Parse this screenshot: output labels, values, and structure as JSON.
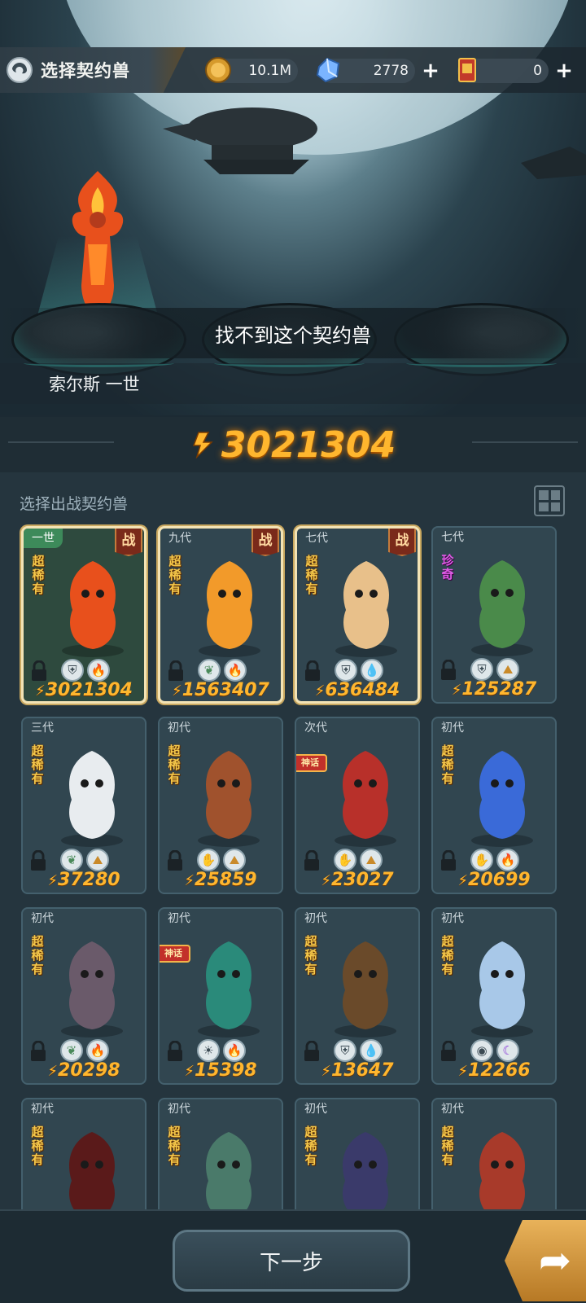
{
  "header": {
    "title": "选择契约兽",
    "gold": "10.1M",
    "crystals": "2778",
    "tickets": "0"
  },
  "stage": {
    "status_message": "找不到这个契约兽",
    "hero_name": "索尔斯 一世",
    "total_power": "3021304"
  },
  "list": {
    "section_label": "选择出战契约兽",
    "cards": [
      {
        "gen": "一世",
        "rarity": "超稀有",
        "power": "3021304",
        "battle": "战",
        "elements": [
          "shield-icon",
          "fire-icon"
        ],
        "selected": true,
        "highlight": true
      },
      {
        "gen": "九代",
        "rarity": "超稀有",
        "power": "1563407",
        "battle": "战",
        "elements": [
          "leaf-icon",
          "fire-icon"
        ],
        "selected": true
      },
      {
        "gen": "七代",
        "rarity": "超稀有",
        "power": "636484",
        "battle": "战",
        "elements": [
          "shield-icon",
          "water-icon"
        ],
        "selected": true
      },
      {
        "gen": "七代",
        "rarity": "珍奇",
        "power": "125287",
        "elements": [
          "shield-icon",
          "earth-icon"
        ]
      },
      {
        "gen": "三代",
        "rarity": "超稀有",
        "power": "37280",
        "elements": [
          "leaf-icon",
          "earth-icon"
        ]
      },
      {
        "gen": "初代",
        "rarity": "超稀有",
        "power": "25859",
        "elements": [
          "claw-icon",
          "earth-icon"
        ]
      },
      {
        "gen": "次代",
        "rarity": "",
        "ribbon": "神话",
        "power": "23027",
        "elements": [
          "claw-icon",
          "earth-icon"
        ]
      },
      {
        "gen": "初代",
        "rarity": "超稀有",
        "power": "20699",
        "elements": [
          "claw-icon",
          "fire-icon"
        ]
      },
      {
        "gen": "初代",
        "rarity": "超稀有",
        "power": "20298",
        "elements": [
          "leaf-icon",
          "fire-icon"
        ]
      },
      {
        "gen": "初代",
        "rarity": "",
        "ribbon": "神话",
        "power": "15398",
        "elements": [
          "light-icon",
          "fire-icon"
        ]
      },
      {
        "gen": "初代",
        "rarity": "超稀有",
        "power": "13647",
        "elements": [
          "shield-icon",
          "water-icon"
        ]
      },
      {
        "gen": "初代",
        "rarity": "超稀有",
        "power": "12266",
        "elements": [
          "eye-icon",
          "dark-icon"
        ]
      },
      {
        "gen": "初代",
        "rarity": "超稀有",
        "power": ""
      },
      {
        "gen": "初代",
        "rarity": "超稀有",
        "power": ""
      },
      {
        "gen": "初代",
        "rarity": "超稀有",
        "power": ""
      },
      {
        "gen": "初代",
        "rarity": "超稀有",
        "power": ""
      }
    ]
  },
  "footer": {
    "next_label": "下一步"
  },
  "colors": {
    "power": "#ffb62e",
    "rarity": "#f5c84a",
    "rare_purple": "#e05ce6",
    "selected_border": "#f3e3b5"
  }
}
